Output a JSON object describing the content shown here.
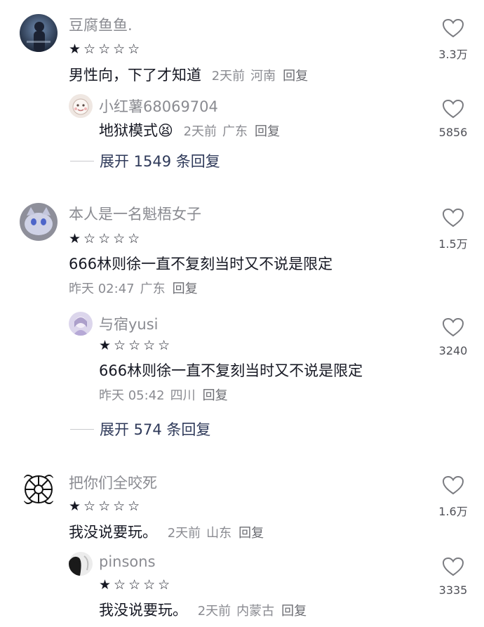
{
  "comments": [
    {
      "username": "豆腐鱼鱼.",
      "rating_stars": "★☆☆☆☆",
      "rating": 1,
      "content": "男性向，下了才知道",
      "time": "2天前",
      "location": "河南",
      "reply_label": "回复",
      "likes": "3.3万",
      "replies": [
        {
          "username": "小红薯68069704",
          "content": "地狱模式",
          "emoji": "😫",
          "time": "2天前",
          "location": "广东",
          "reply_label": "回复",
          "likes": "5856"
        }
      ],
      "expand_label": "展开 1549 条回复"
    },
    {
      "username": "本人是一名魁梧女子",
      "rating_stars": "★☆☆☆☆",
      "rating": 1,
      "content": "666林则徐一直不复刻当时又不说是限定",
      "time": "昨天 02:47",
      "location": "广东",
      "reply_label": "回复",
      "likes": "1.5万",
      "replies": [
        {
          "username": "与宿yusi",
          "rating_stars": "★☆☆☆☆",
          "rating": 1,
          "content": "666林则徐一直不复刻当时又不说是限定",
          "time": "昨天 05:42",
          "location": "四川",
          "reply_label": "回复",
          "likes": "3240"
        }
      ],
      "expand_label": "展开 574 条回复"
    },
    {
      "username": "把你们全咬死",
      "rating_stars": "★☆☆☆☆",
      "rating": 1,
      "content": "我没说要玩。",
      "time": "2天前",
      "location": "山东",
      "reply_label": "回复",
      "likes": "1.6万",
      "replies": [
        {
          "username": "pinsons",
          "rating_stars": "★☆☆☆☆",
          "rating": 1,
          "content": "我没说要玩。",
          "time": "2天前",
          "location": "内蒙古",
          "reply_label": "回复",
          "likes": "3335"
        }
      ]
    }
  ],
  "icons": {
    "like": "heart-outline-icon"
  },
  "colors": {
    "text": "#161823",
    "muted": "#8a8b91",
    "expand": "#2f3a5a"
  }
}
